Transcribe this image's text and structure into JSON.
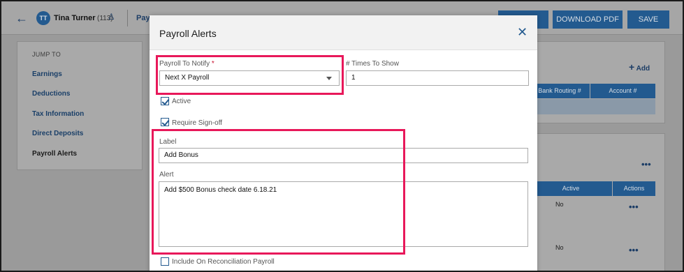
{
  "header": {
    "back_icon": "arrow-left-icon",
    "avatar_initials": "TT",
    "employee_name": "Tina Turner",
    "employee_count": "(113)",
    "user_edit_icon": "user-edit-icon",
    "payroll_link": "Pay",
    "buttons": {
      "blank": "",
      "download_pdf": "DOWNLOAD PDF",
      "save": "SAVE"
    }
  },
  "jump_to": {
    "title": "JUMP TO",
    "items": [
      "Earnings",
      "Deductions",
      "Tax Information",
      "Direct Deposits",
      "Payroll Alerts"
    ],
    "active": "Payroll Alerts"
  },
  "background": {
    "add_label": "Add",
    "add_icon": "plus-icon",
    "deposit_columns": [
      "Bank Routing #",
      "Account #"
    ],
    "alert_columns": [
      "Active",
      "Actions"
    ],
    "rows": [
      {
        "active": "No",
        "actions_icon": "more-dots-icon"
      },
      {
        "active": "No",
        "actions_icon": "more-dots-icon"
      }
    ]
  },
  "modal": {
    "title": "Payroll Alerts",
    "close_icon": "close-icon",
    "payroll_to_notify_label": "Payroll To Notify",
    "payroll_to_notify_required": "*",
    "payroll_to_notify_value": "Next X Payroll",
    "times_to_show_label": "# Times To Show",
    "times_to_show_value": "1",
    "active_label": "Active",
    "active_checked": true,
    "require_signoff_label": "Require Sign-off",
    "require_signoff_checked": true,
    "label_label": "Label",
    "label_value": "Add Bonus",
    "alert_label": "Alert",
    "alert_value": "Add $500 Bonus check date 6.18.21",
    "include_reconciliation_label": "Include On Reconciliation Payroll",
    "include_reconciliation_checked": false
  },
  "colors": {
    "primary": "#235a8f",
    "highlight": "#e8185a",
    "required": "#c8102e"
  }
}
